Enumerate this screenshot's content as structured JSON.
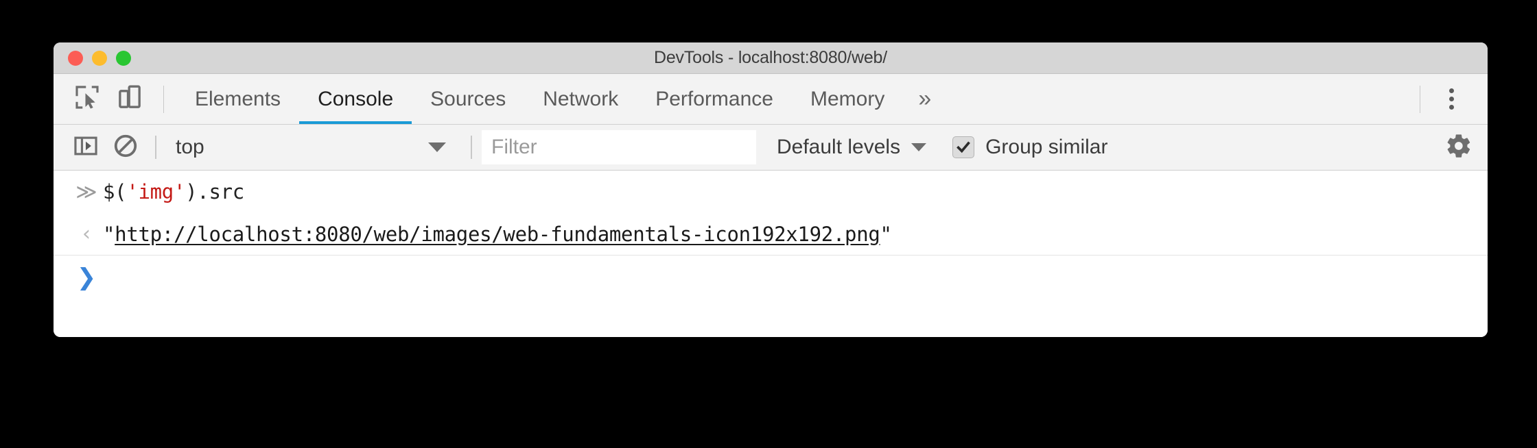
{
  "window": {
    "title": "DevTools - localhost:8080/web/",
    "traffic_lights": [
      {
        "name": "close",
        "color": "#fc5d55"
      },
      {
        "name": "minimize",
        "color": "#fdbc2d"
      },
      {
        "name": "maximize",
        "color": "#29c632"
      }
    ]
  },
  "tabbar": {
    "icons": [
      {
        "name": "inspect-element-icon"
      },
      {
        "name": "device-toolbar-icon"
      }
    ],
    "tabs": [
      {
        "label": "Elements",
        "active": false
      },
      {
        "label": "Console",
        "active": true
      },
      {
        "label": "Sources",
        "active": false
      },
      {
        "label": "Network",
        "active": false
      },
      {
        "label": "Performance",
        "active": false
      },
      {
        "label": "Memory",
        "active": false
      }
    ],
    "overflow_label": "»",
    "active_tab_underline_color": "#1a9ad6",
    "more_menu_icon": "kebab-menu-icon"
  },
  "console_toolbar": {
    "sidebar_toggle_icon": "console-sidebar-icon",
    "clear_console_icon": "clear-console-icon",
    "context": {
      "selected": "top",
      "options": [
        "top"
      ]
    },
    "filter": {
      "value": "",
      "placeholder": "Filter"
    },
    "levels": {
      "label": "Default levels"
    },
    "group_similar": {
      "label": "Group similar",
      "checked": true
    },
    "settings_icon": "gear-icon"
  },
  "console": {
    "entries": [
      {
        "type": "input",
        "marker": "≫",
        "code_prefix": "$(",
        "code_string": "'img'",
        "code_suffix": ").src"
      },
      {
        "type": "result",
        "marker": "‹",
        "quote_open": "\"",
        "url": "http://localhost:8080/web/images/web-fundamentals-icon192x192.png",
        "quote_close": "\""
      }
    ],
    "prompt": {
      "marker": "❯",
      "value": ""
    }
  }
}
